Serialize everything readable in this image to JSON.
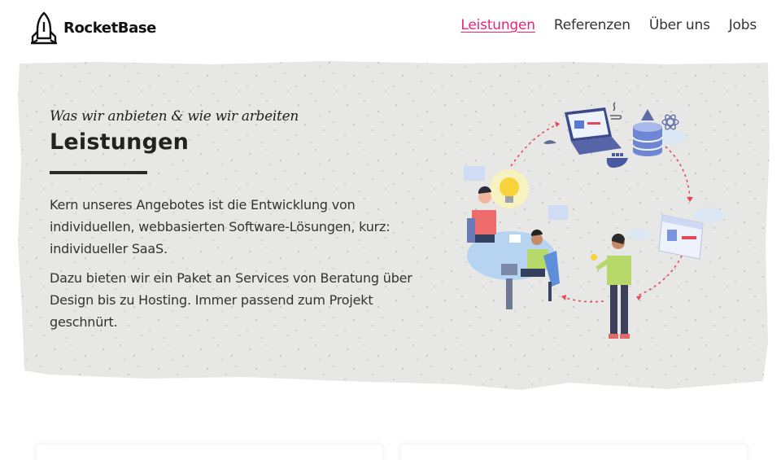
{
  "brand": {
    "name": "RocketBase"
  },
  "nav": {
    "items": [
      {
        "label": "Leistungen",
        "active": true
      },
      {
        "label": "Referenzen",
        "active": false
      },
      {
        "label": "Über uns",
        "active": false
      },
      {
        "label": "Jobs",
        "active": false
      }
    ]
  },
  "hero": {
    "kicker": "Was wir anbieten & wie wir arbeiten",
    "title": "Leistungen",
    "paragraph1": "Kern unseres Angebotes ist die Entwicklung von individuellen, webbasierten Software-Lösungen, kurz: individueller SaaS.",
    "paragraph2": "Dazu bieten wir ein Paket an Services von Beratung über Design bis zu Hosting. Immer passend zum Projekt geschnürt."
  },
  "colors": {
    "accent": "#e8237a",
    "concrete": "#e6e6e4",
    "text": "#333333"
  },
  "icons": [
    "rocket-logo-icon",
    "laptop-icon",
    "java-icon",
    "database-icon",
    "react-icon",
    "docker-icon",
    "lightbulb-icon",
    "browser-window-icon"
  ]
}
